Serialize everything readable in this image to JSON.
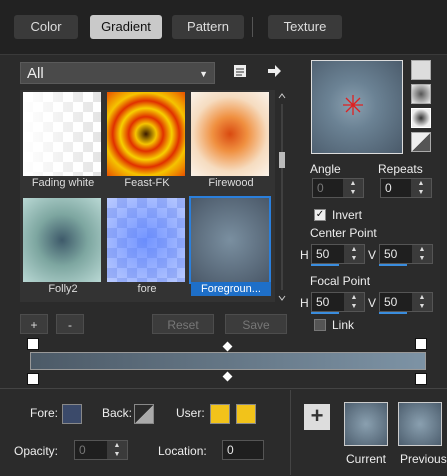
{
  "tabs": [
    {
      "label": "Color"
    },
    {
      "label": "Gradient",
      "active": true
    },
    {
      "label": "Pattern"
    },
    {
      "label": "Texture"
    }
  ],
  "category": {
    "selected": "All"
  },
  "gallery": [
    {
      "label": "Fading white"
    },
    {
      "label": "Feast-FK"
    },
    {
      "label": "Firewood"
    },
    {
      "label": "Folly2"
    },
    {
      "label": "fore"
    },
    {
      "label": "Foregroun...",
      "selected": true
    }
  ],
  "buttons": {
    "add": "+",
    "remove": "-",
    "reset": "Reset",
    "save": "Save"
  },
  "angle": {
    "label": "Angle",
    "value": "0"
  },
  "repeats": {
    "label": "Repeats",
    "value": "0"
  },
  "invert": {
    "label": "Invert",
    "checked": true
  },
  "center_point": {
    "label": "Center Point",
    "h_label": "H",
    "h": "50",
    "v_label": "V",
    "v": "50"
  },
  "focal_point": {
    "label": "Focal Point",
    "h_label": "H",
    "h": "50",
    "v_label": "V",
    "v": "50"
  },
  "link": {
    "label": "Link",
    "checked": false
  },
  "bottom": {
    "fore_label": "Fore:",
    "back_label": "Back:",
    "user_label": "User:",
    "opacity_label": "Opacity:",
    "opacity_value": "0",
    "location_label": "Location:",
    "location_value": "0",
    "current_label": "Current",
    "previous_label": "Previous",
    "plus": "+"
  },
  "colors": {
    "accent": "#2a7fdc",
    "user": "#f2c31a",
    "gradient_start": "#4c5a67",
    "gradient_end": "#7d93a5"
  }
}
